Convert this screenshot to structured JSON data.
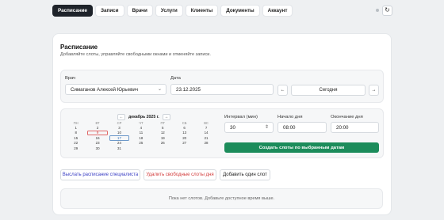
{
  "nav": {
    "tabs": [
      {
        "label": "Расписание",
        "active": true
      },
      {
        "label": "Записи",
        "active": false
      },
      {
        "label": "Врачи",
        "active": false
      },
      {
        "label": "Услуги",
        "active": false
      },
      {
        "label": "Клиенты",
        "active": false
      },
      {
        "label": "Документы",
        "active": false
      },
      {
        "label": "Аккаунт",
        "active": false
      }
    ],
    "refresh_icon": "↻"
  },
  "page": {
    "title": "Расписание",
    "subtitle": "Добавляйте слоты, управляйте свободными окнами и отменяйте записи."
  },
  "filters": {
    "doctor_label": "Врач",
    "doctor_value": "Симаганов Алексей Юрьевич",
    "date_label": "Дата",
    "date_value": "23.12.2025",
    "prev_icon": "←",
    "next_icon": "→",
    "today_label": "Сегодня"
  },
  "calendar": {
    "month_label": "декабрь 2025 г.",
    "prev_icon": "←",
    "next_icon": "→",
    "weekdays": [
      "ПН",
      "ВТ",
      "СР",
      "ЧТ",
      "ПТ",
      "СБ",
      "ВС"
    ],
    "days": [
      "1",
      "2",
      "3",
      "4",
      "5",
      "6",
      "7",
      "8",
      "9",
      "10",
      "11",
      "12",
      "13",
      "14",
      "15",
      "16",
      "17",
      "18",
      "19",
      "20",
      "21",
      "22",
      "23",
      "24",
      "25",
      "26",
      "27",
      "28",
      "29",
      "30",
      "31"
    ],
    "selected_day": "9",
    "today_day": "17"
  },
  "slot_form": {
    "interval_label": "Интервал (мин)",
    "interval_value": "30",
    "start_label": "Начало дня",
    "start_value": "08:00",
    "end_label": "Окончание дня",
    "end_value": "20:00",
    "create_button": "Создать слоты по выбранным датам"
  },
  "actions": {
    "send_schedule": "Выслать расписание специалиста",
    "delete_free": "Удалить свободные слоты дня",
    "add_one": "Добавить один слот"
  },
  "colors": {
    "send_schedule": "#3b3fc4",
    "delete_free": "#d23b3b",
    "primary": "#1c8c5b"
  },
  "empty_state": "Пока нет слотов. Добавьте доступное время выше."
}
